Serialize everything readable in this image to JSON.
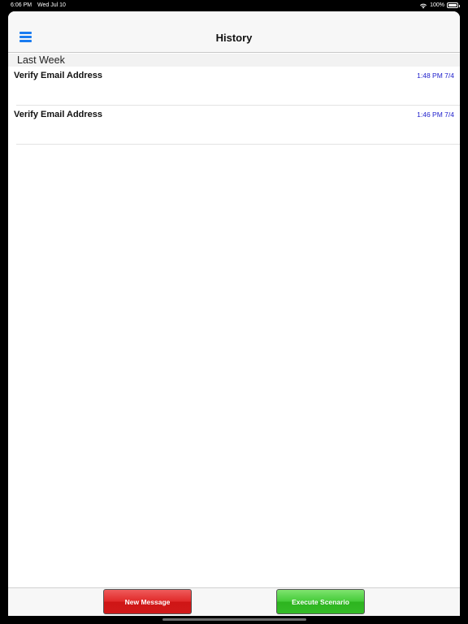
{
  "status_bar": {
    "time": "6:06 PM",
    "date": "Wed Jul 10",
    "battery": "100%",
    "icons": [
      "wifi-icon",
      "battery-icon"
    ]
  },
  "nav": {
    "title": "History",
    "menu_icon": "hamburger-menu-icon",
    "accent": "#1a7cf0"
  },
  "history": {
    "section_title": "Last Week",
    "items": [
      {
        "title": "Verify Email Address",
        "time": "1:48 PM 7/4"
      },
      {
        "title": "Verify Email Address",
        "time": "1:46 PM 7/4"
      }
    ]
  },
  "toolbar": {
    "new_message_label": "New Message",
    "execute_scenario_label": "Execute Scenario",
    "new_message_color": "#e12a2a",
    "execute_scenario_color": "#46cc3a"
  }
}
